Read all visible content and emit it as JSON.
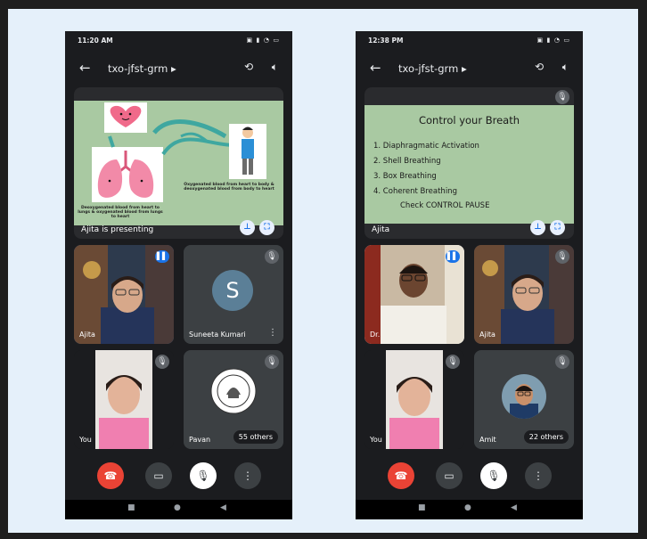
{
  "phones": [
    {
      "status_time": "11:20 AM",
      "meeting_code": "txo-jfst-grm",
      "presenter_label": "Ajita is presenting",
      "slide_caption_left": "Deoxygenated blood from heart to lungs & oxygenated blood from lungs to heart",
      "slide_caption_right": "Oxygenated blood from heart to body & deoxygenated blood from body to heart",
      "tiles": [
        {
          "name": "Ajita"
        },
        {
          "name": "Suneeta Kumari",
          "avatar_letter": "S"
        },
        {
          "name": "You"
        },
        {
          "name": "Pavan",
          "others": "55 others"
        }
      ]
    },
    {
      "status_time": "12:38 PM",
      "meeting_code": "txo-jfst-grm",
      "presenter_label": "Ajita",
      "slide_title": "Control your Breath",
      "slide_items": [
        "1. Diaphragmatic Activation",
        "2. Shell Breathing",
        "3. Box Breathing",
        "4. Coherent Breathing"
      ],
      "slide_footer": "Check CONTROL PAUSE",
      "tiles": [
        {
          "name": "Dr."
        },
        {
          "name": "Ajita"
        },
        {
          "name": "You"
        },
        {
          "name": "Amit",
          "others": "22 others"
        }
      ]
    }
  ],
  "icons": {
    "back": "arrow-left",
    "switch_camera": "camera-switch",
    "speaker": "speaker",
    "pin": "pin",
    "fullscreen": "fullscreen",
    "mic_off": "mic-off",
    "end_call": "phone-hangup",
    "video": "video-camera",
    "more": "more-vertical"
  },
  "colors": {
    "end_call": "#ea4335",
    "speaking": "#1a73e8",
    "slide_bg": "#a9c9a2"
  }
}
